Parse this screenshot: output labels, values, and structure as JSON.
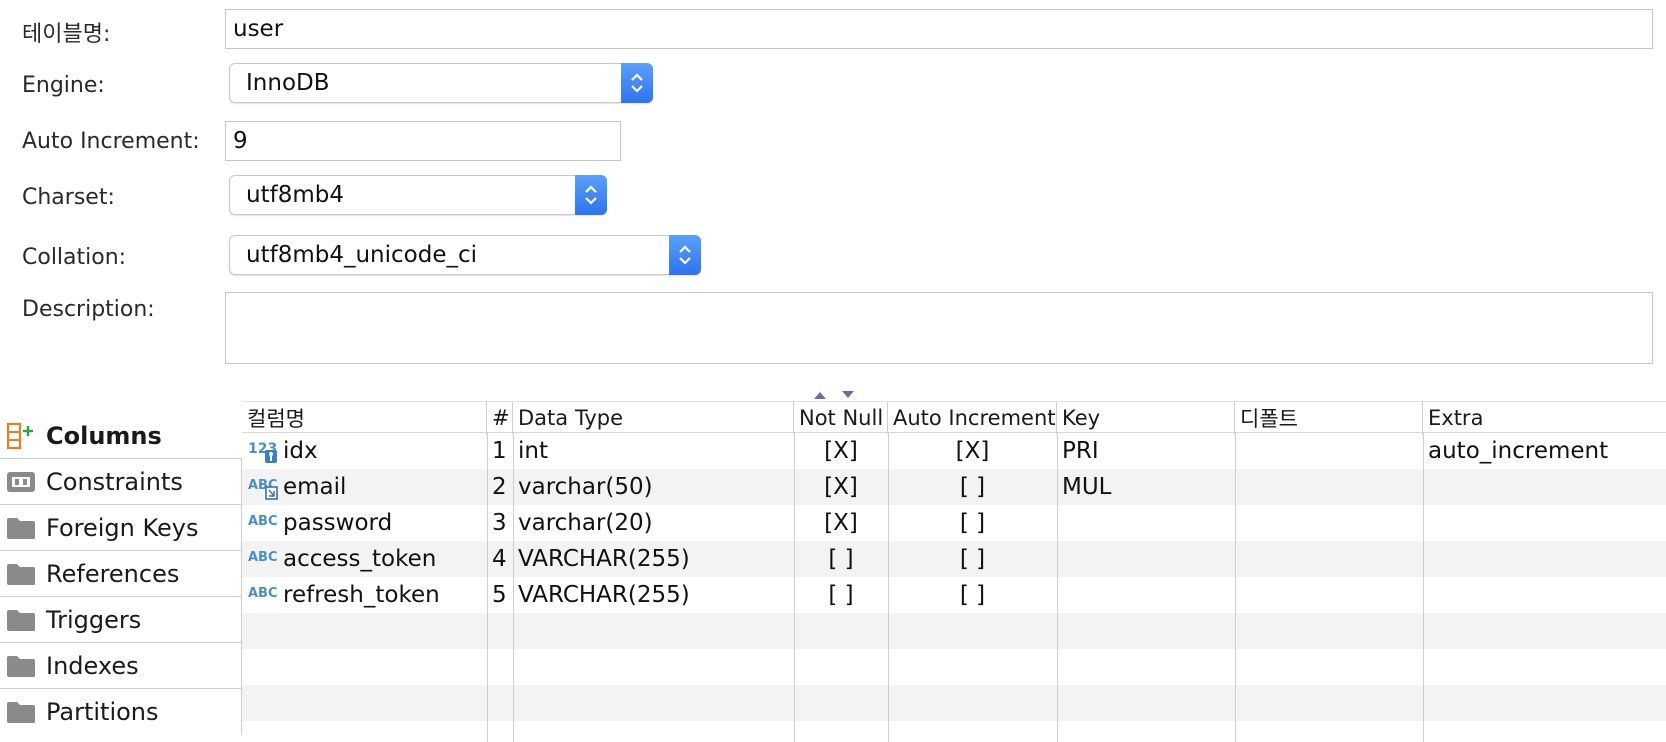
{
  "form": {
    "table_name": {
      "label": "테이블명:",
      "value": "user"
    },
    "engine": {
      "label": "Engine:",
      "value": "InnoDB"
    },
    "auto_increment": {
      "label": "Auto Increment:",
      "value": "9"
    },
    "charset": {
      "label": "Charset:",
      "value": "utf8mb4"
    },
    "collation": {
      "label": "Collation:",
      "value": "utf8mb4_unicode_ci"
    },
    "description": {
      "label": "Description:",
      "value": ""
    }
  },
  "tabs": [
    {
      "label": "Columns",
      "icon": "columns-add-icon",
      "active": true
    },
    {
      "label": "Constraints",
      "icon": "constraints-icon",
      "active": false
    },
    {
      "label": "Foreign Keys",
      "icon": "folder-icon",
      "active": false
    },
    {
      "label": "References",
      "icon": "folder-icon",
      "active": false
    },
    {
      "label": "Triggers",
      "icon": "folder-icon",
      "active": false
    },
    {
      "label": "Indexes",
      "icon": "folder-icon",
      "active": false
    },
    {
      "label": "Partitions",
      "icon": "folder-icon",
      "active": false
    }
  ],
  "grid": {
    "headers": [
      "컬럼명",
      "#",
      "Data Type",
      "Not Null",
      "Auto Increment",
      "Key",
      "디폴트",
      "Extra"
    ],
    "rows": [
      {
        "icon": "numeric-key-icon",
        "name": "idx",
        "num": "1",
        "type": "int",
        "not_null": "[X]",
        "auto_inc": "[X]",
        "key": "PRI",
        "default": "",
        "extra": "auto_increment"
      },
      {
        "icon": "text-index-icon",
        "name": "email",
        "num": "2",
        "type": "varchar(50)",
        "not_null": "[X]",
        "auto_inc": "[ ]",
        "key": "MUL",
        "default": "",
        "extra": ""
      },
      {
        "icon": "text-icon",
        "name": "password",
        "num": "3",
        "type": "varchar(20)",
        "not_null": "[X]",
        "auto_inc": "[ ]",
        "key": "",
        "default": "",
        "extra": ""
      },
      {
        "icon": "text-icon",
        "name": "access_token",
        "num": "4",
        "type": "VARCHAR(255)",
        "not_null": "[ ]",
        "auto_inc": "[ ]",
        "key": "",
        "default": "",
        "extra": ""
      },
      {
        "icon": "text-icon",
        "name": "refresh_token",
        "num": "5",
        "type": "VARCHAR(255)",
        "not_null": "[ ]",
        "auto_inc": "[ ]",
        "key": "",
        "default": "",
        "extra": ""
      }
    ]
  },
  "colors": {
    "accent": "#2f73ee",
    "grid_alt_row": "#f3f3f3",
    "icon_blue": "#4a90c8",
    "icon_orange": "#e67e22",
    "folder_gray": "#8a8a8a"
  }
}
